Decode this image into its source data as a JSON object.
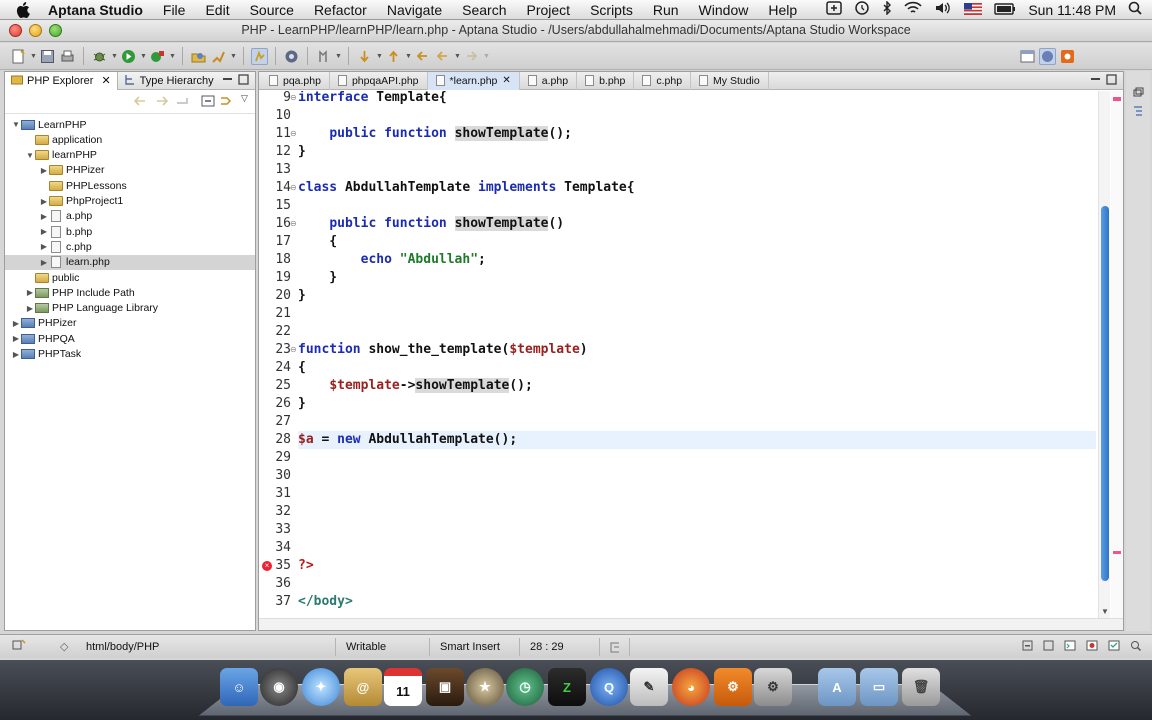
{
  "menubar": {
    "app": "Aptana Studio",
    "items": [
      "File",
      "Edit",
      "Source",
      "Refactor",
      "Navigate",
      "Search",
      "Project",
      "Scripts",
      "Run",
      "Window",
      "Help"
    ],
    "clock": "Sun 11:48 PM"
  },
  "window": {
    "title": "PHP - LearnPHP/learnPHP/learn.php - Aptana Studio - /Users/abdullahalmehmadi/Documents/Aptana Studio Workspace"
  },
  "explorer": {
    "tabs": [
      "PHP Explorer",
      "Type Hierarchy"
    ],
    "tree": [
      {
        "label": "LearnPHP",
        "level": 0,
        "kind": "proj",
        "expanded": true
      },
      {
        "label": "application",
        "level": 1,
        "kind": "folder",
        "expanded": null
      },
      {
        "label": "learnPHP",
        "level": 1,
        "kind": "folder",
        "expanded": true
      },
      {
        "label": "PHPizer",
        "level": 2,
        "kind": "folder",
        "expanded": false
      },
      {
        "label": "PHPLessons",
        "level": 2,
        "kind": "folder",
        "expanded": null
      },
      {
        "label": "PhpProject1",
        "level": 2,
        "kind": "folder",
        "expanded": false
      },
      {
        "label": "a.php",
        "level": 2,
        "kind": "file",
        "expanded": false
      },
      {
        "label": "b.php",
        "level": 2,
        "kind": "file",
        "expanded": false
      },
      {
        "label": "c.php",
        "level": 2,
        "kind": "file",
        "expanded": false
      },
      {
        "label": "learn.php",
        "level": 2,
        "kind": "file",
        "expanded": false,
        "selected": true
      },
      {
        "label": "public",
        "level": 1,
        "kind": "folder",
        "expanded": null
      },
      {
        "label": "PHP Include Path",
        "level": 1,
        "kind": "lib",
        "expanded": false
      },
      {
        "label": "PHP Language Library",
        "level": 1,
        "kind": "lib",
        "expanded": false
      },
      {
        "label": "PHPizer",
        "level": 0,
        "kind": "proj",
        "expanded": false
      },
      {
        "label": "PHPQA",
        "level": 0,
        "kind": "proj",
        "expanded": false
      },
      {
        "label": "PHPTask",
        "level": 0,
        "kind": "proj",
        "expanded": false
      }
    ]
  },
  "editor": {
    "tabs": [
      {
        "label": "pqa.php",
        "active": false
      },
      {
        "label": "phpqaAPI.php",
        "active": false
      },
      {
        "label": "*learn.php",
        "active": true
      },
      {
        "label": "a.php",
        "active": false
      },
      {
        "label": "b.php",
        "active": false
      },
      {
        "label": "c.php",
        "active": false
      },
      {
        "label": "My Studio",
        "active": false
      }
    ],
    "lines": [
      {
        "n": "9",
        "fold": true,
        "parts": [
          [
            "kw",
            "interface"
          ],
          [
            "p",
            " Template{"
          ]
        ]
      },
      {
        "n": "10",
        "parts": []
      },
      {
        "n": "11",
        "fold": true,
        "parts": [
          [
            "p",
            "    "
          ],
          [
            "kw",
            "public"
          ],
          [
            "p",
            " "
          ],
          [
            "kw",
            "function"
          ],
          [
            "p",
            " "
          ],
          [
            "occ",
            "showTemplate"
          ],
          [
            "p",
            "();"
          ]
        ]
      },
      {
        "n": "12",
        "parts": [
          [
            "p",
            "}"
          ]
        ]
      },
      {
        "n": "13",
        "parts": []
      },
      {
        "n": "14",
        "fold": true,
        "parts": [
          [
            "kw",
            "class"
          ],
          [
            "p",
            " AbdullahTemplate "
          ],
          [
            "kw",
            "implements"
          ],
          [
            "p",
            " Template{"
          ]
        ]
      },
      {
        "n": "15",
        "parts": []
      },
      {
        "n": "16",
        "fold": true,
        "parts": [
          [
            "p",
            "    "
          ],
          [
            "kw",
            "public"
          ],
          [
            "p",
            " "
          ],
          [
            "kw",
            "function"
          ],
          [
            "p",
            " "
          ],
          [
            "occ",
            "showTemplate"
          ],
          [
            "p",
            "()"
          ]
        ]
      },
      {
        "n": "17",
        "parts": [
          [
            "p",
            "    {"
          ]
        ]
      },
      {
        "n": "18",
        "parts": [
          [
            "p",
            "        "
          ],
          [
            "kw",
            "echo"
          ],
          [
            "p",
            " "
          ],
          [
            "str",
            "\"Abdullah\""
          ],
          [
            "p",
            ";"
          ]
        ]
      },
      {
        "n": "19",
        "parts": [
          [
            "p",
            "    }"
          ]
        ]
      },
      {
        "n": "20",
        "parts": [
          [
            "p",
            "}"
          ]
        ]
      },
      {
        "n": "21",
        "parts": []
      },
      {
        "n": "22",
        "parts": []
      },
      {
        "n": "23",
        "fold": true,
        "parts": [
          [
            "kw",
            "function"
          ],
          [
            "p",
            " show_the_template("
          ],
          [
            "var",
            "$template"
          ],
          [
            "p",
            ")"
          ]
        ]
      },
      {
        "n": "24",
        "parts": [
          [
            "p",
            "{"
          ]
        ]
      },
      {
        "n": "25",
        "parts": [
          [
            "p",
            "    "
          ],
          [
            "var",
            "$template"
          ],
          [
            "p",
            "->"
          ],
          [
            "occ",
            "showTemplate"
          ],
          [
            "p",
            "();"
          ]
        ]
      },
      {
        "n": "26",
        "parts": [
          [
            "p",
            "}"
          ]
        ]
      },
      {
        "n": "27",
        "parts": []
      },
      {
        "n": "28",
        "current": true,
        "parts": [
          [
            "var",
            "$a"
          ],
          [
            "p",
            " = "
          ],
          [
            "kw",
            "new"
          ],
          [
            "p",
            " AbdullahTemplate();"
          ]
        ]
      },
      {
        "n": "29",
        "parts": []
      },
      {
        "n": "30",
        "parts": []
      },
      {
        "n": "31",
        "parts": []
      },
      {
        "n": "32",
        "parts": []
      },
      {
        "n": "33",
        "parts": []
      },
      {
        "n": "34",
        "parts": []
      },
      {
        "n": "35",
        "error": true,
        "parts": [
          [
            "php",
            "?>"
          ]
        ]
      },
      {
        "n": "36",
        "parts": []
      },
      {
        "n": "37",
        "parts": [
          [
            "tag",
            "</body>"
          ]
        ]
      }
    ]
  },
  "status": {
    "breadcrumb": "html/body/PHP",
    "writable": "Writable",
    "insert": "Smart Insert",
    "position": "28 : 29"
  },
  "colors": {
    "keyword": "#1b2bb4",
    "variable": "#9a1f1f",
    "string": "#1f7a2a",
    "current_line": "#e8f2fe",
    "scroll_thumb": "#2f74c8"
  }
}
